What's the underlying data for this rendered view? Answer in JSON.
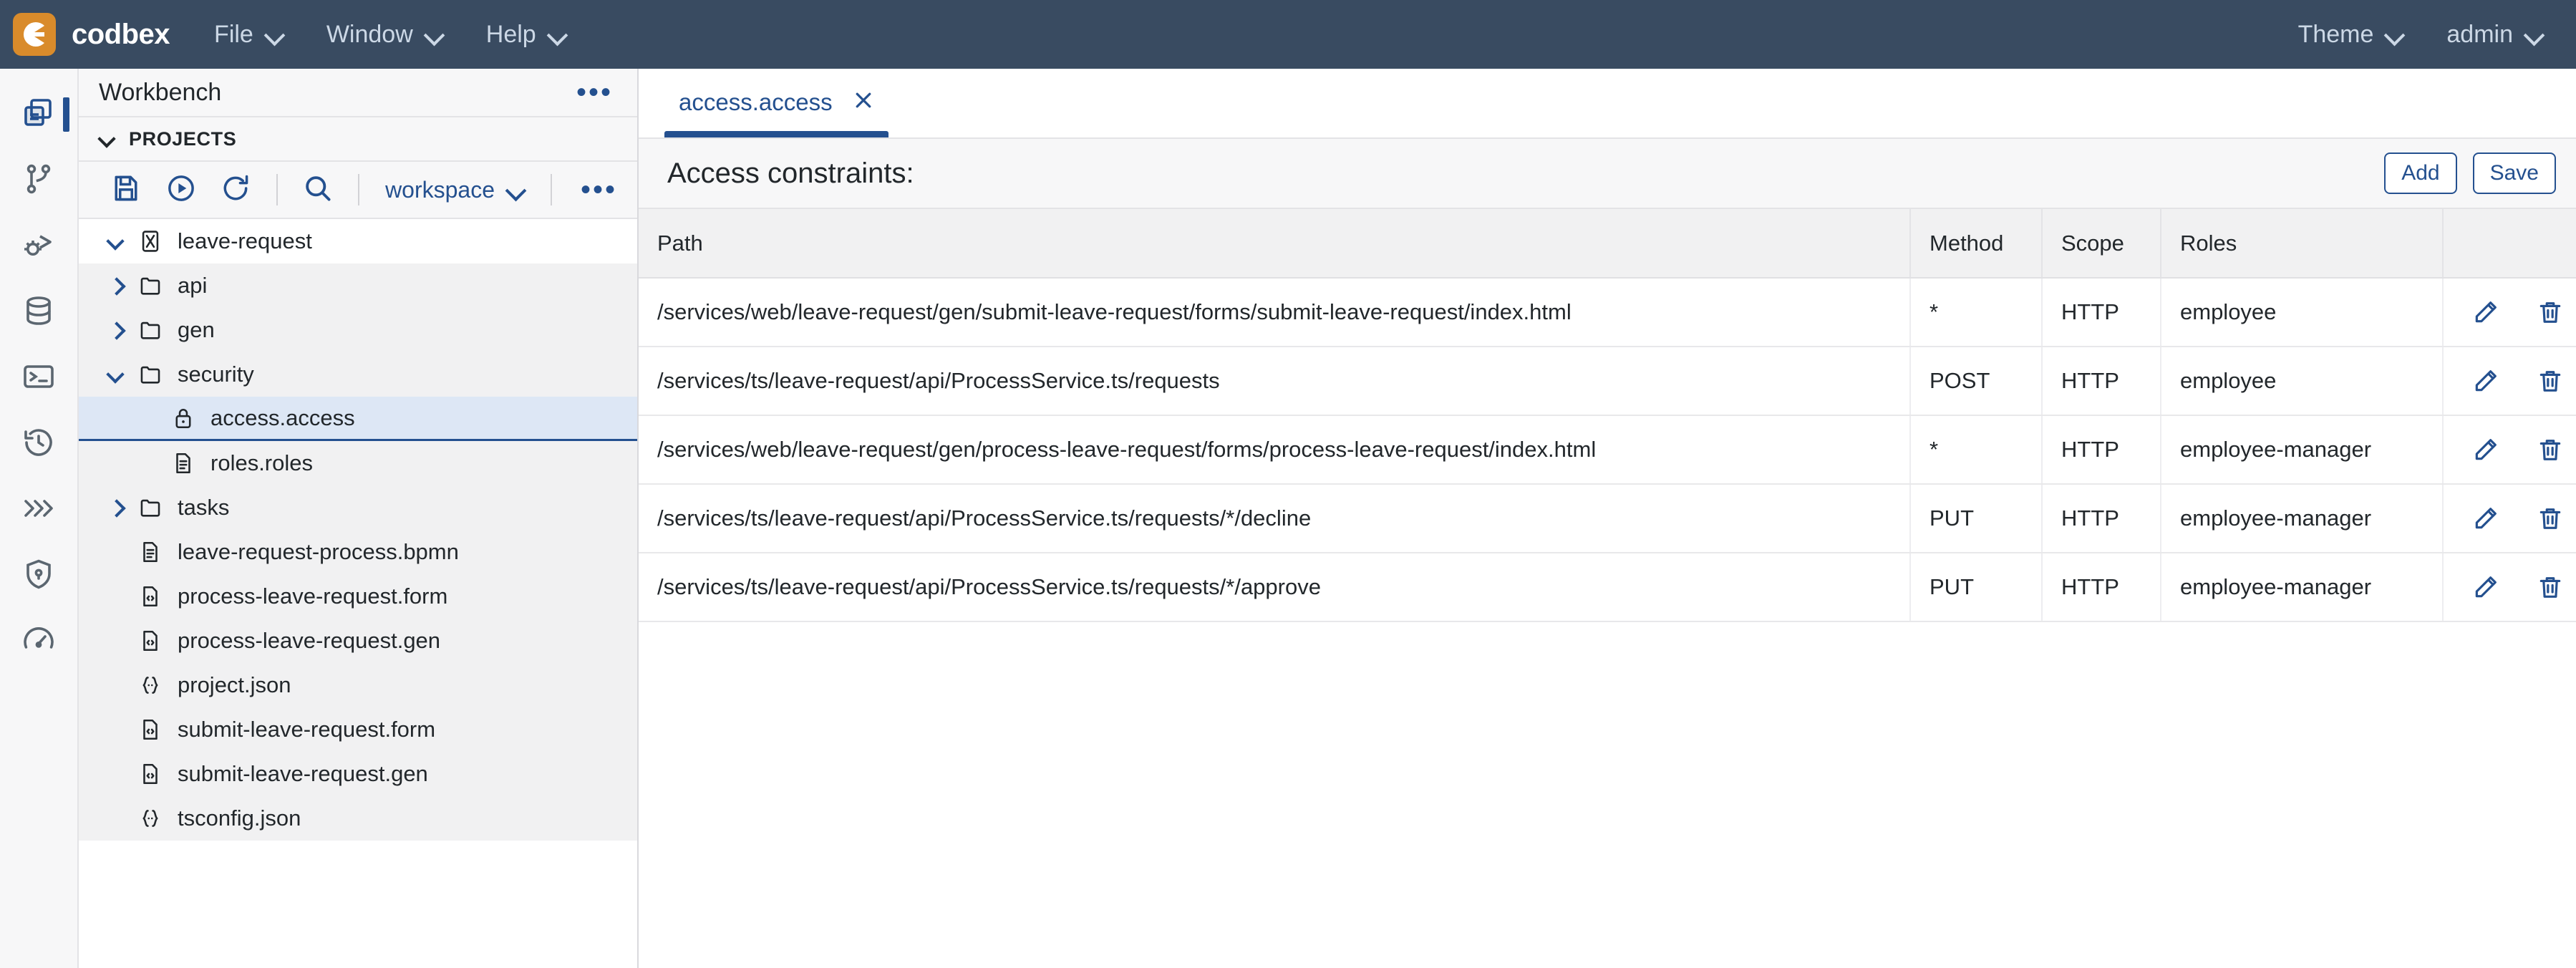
{
  "header": {
    "logo_icon": "codbex-logo-icon",
    "brand": "codbex",
    "menus": [
      {
        "label": "File",
        "icon": "chevron-down-icon"
      },
      {
        "label": "Window",
        "icon": "chevron-down-icon"
      },
      {
        "label": "Help",
        "icon": "chevron-down-icon"
      }
    ],
    "theme_label": "Theme",
    "user_label": "admin",
    "bg_color": "#394b61",
    "logo_color": "#d98b2b"
  },
  "activity_bar": {
    "items": [
      {
        "name": "workbench-icon",
        "active": true
      },
      {
        "name": "git-branch-icon",
        "active": false
      },
      {
        "name": "debugger-icon",
        "active": false
      },
      {
        "name": "database-icon",
        "active": false
      },
      {
        "name": "terminal-icon",
        "active": false
      },
      {
        "name": "history-icon",
        "active": false
      },
      {
        "name": "jobs-icon",
        "active": false
      },
      {
        "name": "security-shield-icon",
        "active": false
      },
      {
        "name": "gauge-icon",
        "active": false
      }
    ]
  },
  "sidebar": {
    "title": "Workbench",
    "more_icon": "ellipsis-icon",
    "section": {
      "label": "PROJECTS",
      "expanded": true,
      "chevron_icon": "chevron-down-icon"
    },
    "toolbar": {
      "buttons": [
        {
          "name": "save-icon"
        },
        {
          "name": "publish-run-icon"
        },
        {
          "name": "refresh-icon"
        },
        {
          "name": "search-icon"
        }
      ],
      "dropdown_label": "workspace",
      "dropdown_icon": "chevron-down-icon",
      "more_icon": "ellipsis-icon"
    },
    "tree": [
      {
        "label": "leave-request",
        "icon": "project-icon",
        "depth": 0,
        "state": "expanded",
        "twisty": "chevron-down-icon",
        "root": true,
        "selected": false
      },
      {
        "label": "api",
        "icon": "folder-icon",
        "depth": 1,
        "state": "collapsed",
        "twisty": "chevron-right-icon",
        "root": false,
        "selected": false
      },
      {
        "label": "gen",
        "icon": "folder-icon",
        "depth": 1,
        "state": "collapsed",
        "twisty": "chevron-right-icon",
        "root": false,
        "selected": false
      },
      {
        "label": "security",
        "icon": "folder-icon",
        "depth": 1,
        "state": "expanded",
        "twisty": "chevron-down-icon",
        "root": false,
        "selected": false
      },
      {
        "label": "access.access",
        "icon": "lock-icon",
        "depth": 2,
        "state": "leaf",
        "twisty": "",
        "root": false,
        "selected": true
      },
      {
        "label": "roles.roles",
        "icon": "file-lines-icon",
        "depth": 2,
        "state": "leaf",
        "twisty": "",
        "root": false,
        "selected": false
      },
      {
        "label": "tasks",
        "icon": "folder-icon",
        "depth": 1,
        "state": "collapsed",
        "twisty": "chevron-right-icon",
        "root": false,
        "selected": false
      },
      {
        "label": "leave-request-process.bpmn",
        "icon": "file-lines-icon",
        "depth": 1,
        "state": "leaf",
        "twisty": "",
        "root": false,
        "selected": false
      },
      {
        "label": "process-leave-request.form",
        "icon": "file-code-icon",
        "depth": 1,
        "state": "leaf",
        "twisty": "",
        "root": false,
        "selected": false
      },
      {
        "label": "process-leave-request.gen",
        "icon": "file-code-icon",
        "depth": 1,
        "state": "leaf",
        "twisty": "",
        "root": false,
        "selected": false
      },
      {
        "label": "project.json",
        "icon": "json-icon",
        "depth": 1,
        "state": "leaf",
        "twisty": "",
        "root": false,
        "selected": false
      },
      {
        "label": "submit-leave-request.form",
        "icon": "file-code-icon",
        "depth": 1,
        "state": "leaf",
        "twisty": "",
        "root": false,
        "selected": false
      },
      {
        "label": "submit-leave-request.gen",
        "icon": "file-code-icon",
        "depth": 1,
        "state": "leaf",
        "twisty": "",
        "root": false,
        "selected": false
      },
      {
        "label": "tsconfig.json",
        "icon": "json-icon",
        "depth": 1,
        "state": "leaf",
        "twisty": "",
        "root": false,
        "selected": false
      }
    ]
  },
  "editor": {
    "tabs": [
      {
        "label": "access.access",
        "active": true,
        "close_icon": "close-icon"
      }
    ],
    "title": "Access constraints:",
    "add_label": "Add",
    "save_label": "Save",
    "accent_color": "#24508f",
    "table": {
      "columns": [
        "Path",
        "Method",
        "Scope",
        "Roles",
        ""
      ],
      "rows": [
        {
          "path": "/services/web/leave-request/gen/submit-leave-request/forms/submit-leave-request/index.html",
          "method": "*",
          "scope": "HTTP",
          "roles": "employee",
          "edit_icon": "pencil-icon",
          "delete_icon": "trash-icon"
        },
        {
          "path": "/services/ts/leave-request/api/ProcessService.ts/requests",
          "method": "POST",
          "scope": "HTTP",
          "roles": "employee",
          "edit_icon": "pencil-icon",
          "delete_icon": "trash-icon"
        },
        {
          "path": "/services/web/leave-request/gen/process-leave-request/forms/process-leave-request/index.html",
          "method": "*",
          "scope": "HTTP",
          "roles": "employee-manager",
          "edit_icon": "pencil-icon",
          "delete_icon": "trash-icon"
        },
        {
          "path": "/services/ts/leave-request/api/ProcessService.ts/requests/*/decline",
          "method": "PUT",
          "scope": "HTTP",
          "roles": "employee-manager",
          "edit_icon": "pencil-icon",
          "delete_icon": "trash-icon"
        },
        {
          "path": "/services/ts/leave-request/api/ProcessService.ts/requests/*/approve",
          "method": "PUT",
          "scope": "HTTP",
          "roles": "employee-manager",
          "edit_icon": "pencil-icon",
          "delete_icon": "trash-icon"
        }
      ]
    }
  }
}
